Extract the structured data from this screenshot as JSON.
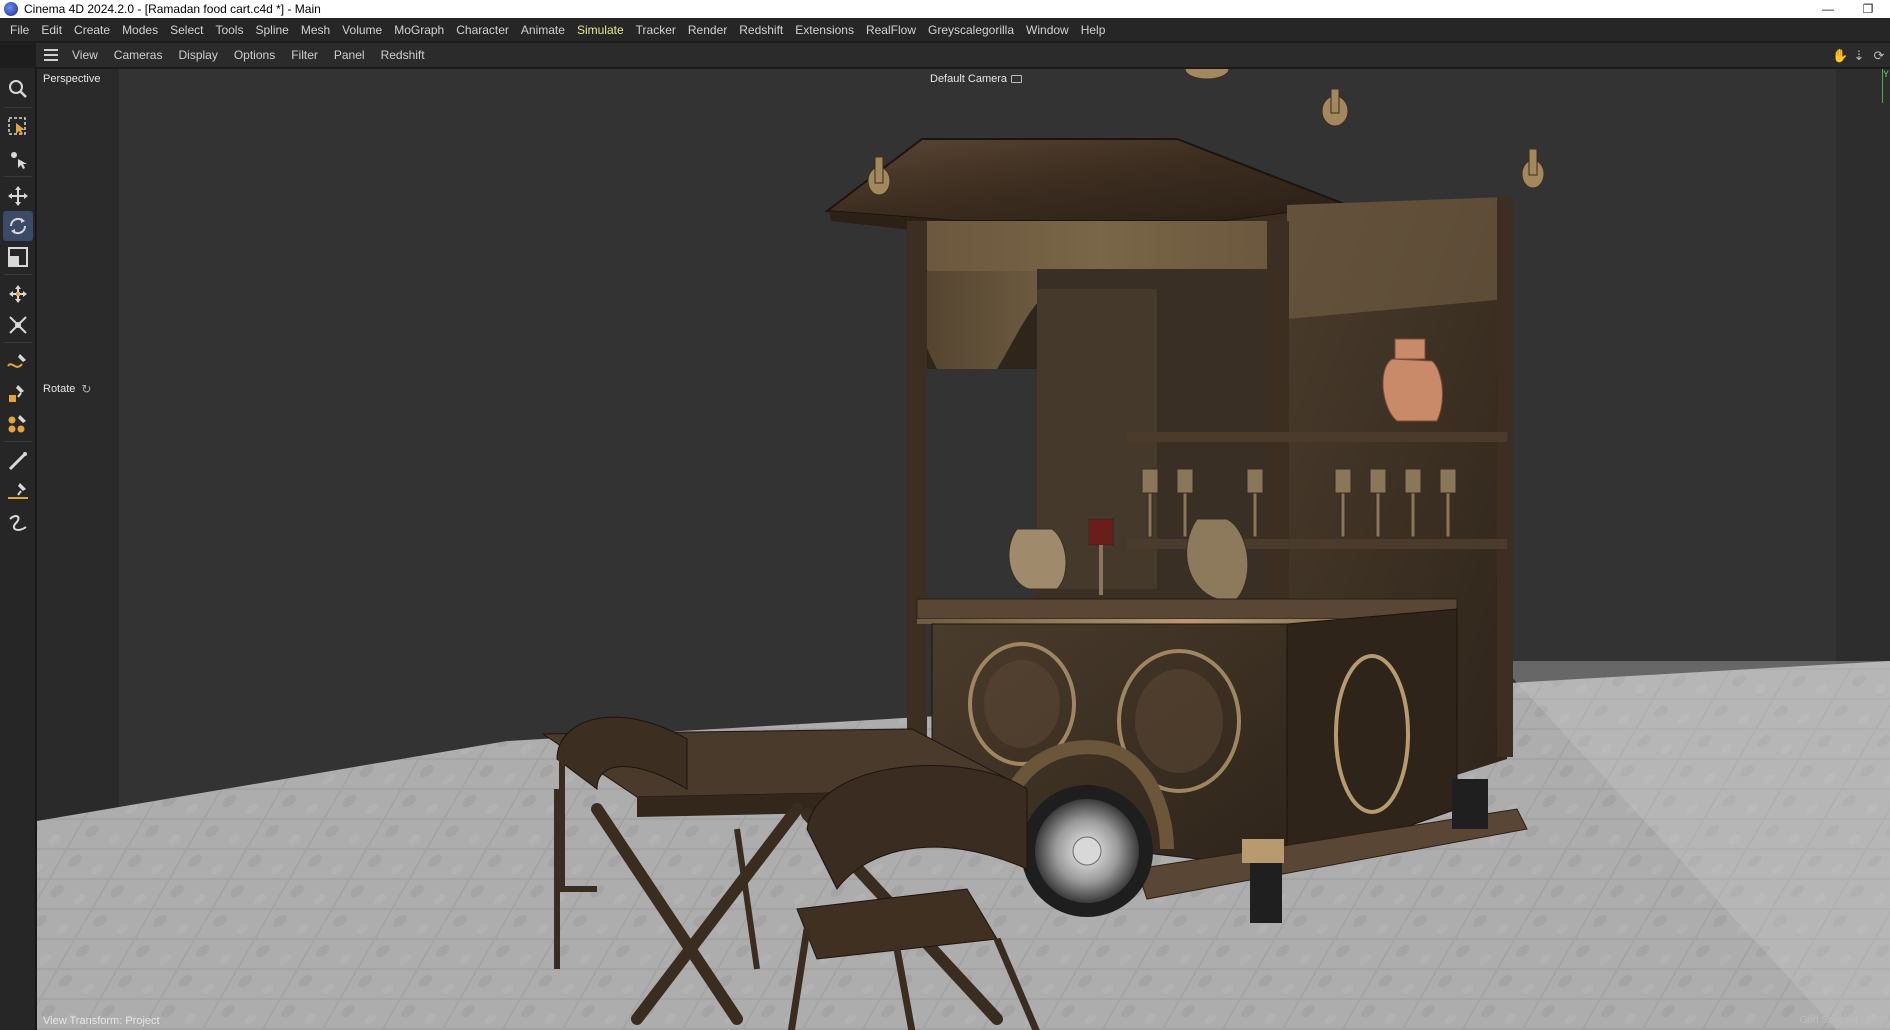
{
  "window": {
    "title": "Cinema 4D 2024.2.0 - [Ramadan food cart.c4d *] - Main",
    "minimize_glyph": "—",
    "restore_glyph": "❐"
  },
  "menubar": {
    "items": [
      "File",
      "Edit",
      "Create",
      "Modes",
      "Select",
      "Tools",
      "Spline",
      "Mesh",
      "Volume",
      "MoGraph",
      "Character",
      "Animate",
      "Simulate",
      "Tracker",
      "Render",
      "Redshift",
      "Extensions",
      "RealFlow",
      "Greyscalegorilla",
      "Window",
      "Help"
    ],
    "active_item": "Simulate",
    "active_color": "#e6e98c"
  },
  "viewport_menu": {
    "items": [
      "View",
      "Cameras",
      "Display",
      "Options",
      "Filter",
      "Panel",
      "Redshift"
    ],
    "nav_icons": [
      "hand-pan-icon",
      "move-down-icon",
      "orbit-icon"
    ]
  },
  "toolbar": {
    "tools": [
      {
        "name": "zoom-icon",
        "active": false
      },
      {
        "name": "live-selection-icon",
        "active": false
      },
      {
        "name": "transform-tool-icon",
        "active": false
      },
      {
        "name": "move-tool-icon",
        "active": false
      },
      {
        "name": "rotate-tool-icon",
        "active": true
      },
      {
        "name": "scale-tool-icon",
        "active": false
      },
      {
        "name": "placement-tool-icon",
        "active": false
      },
      {
        "name": "dynamic-place-icon",
        "active": false
      },
      {
        "name": "spline-pen-icon",
        "active": false
      },
      {
        "name": "cube-create-icon",
        "active": false
      },
      {
        "name": "mograph-cloner-icon",
        "active": false
      },
      {
        "name": "brush-tool-icon",
        "active": false
      },
      {
        "name": "knife-tool-icon",
        "active": false
      },
      {
        "name": "spline-sketch-icon",
        "active": false
      }
    ]
  },
  "viewport": {
    "name": "Perspective",
    "camera": "Default Camera",
    "hud_tool": "Rotate",
    "view_transform": "View Transform: Project",
    "grid_spacing": "Grid Spacing : 5000",
    "axis_label": "Y",
    "scene_description_colors": {
      "background": "#333333",
      "floor": "#a9a9a9",
      "wood_dark": "#3a2c20",
      "brass": "#a08660",
      "copper": "#c98a6a"
    }
  }
}
